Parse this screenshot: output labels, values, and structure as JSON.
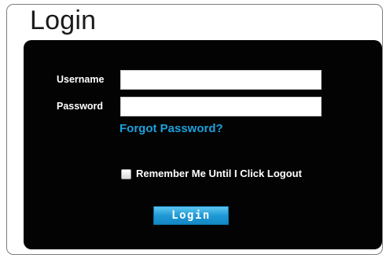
{
  "page": {
    "title": "Login"
  },
  "form": {
    "username_label": "Username",
    "username_value": "",
    "password_label": "Password",
    "password_value": "",
    "forgot_password": "Forgot Password?",
    "remember_me_label": "Remember Me Until I Click Logout",
    "remember_me_checked": false,
    "login_button": "Login"
  },
  "colors": {
    "panel_background": "#030303",
    "link": "#1aa0dc",
    "button": "#1f9ad6",
    "label_text": "#ffffff"
  }
}
